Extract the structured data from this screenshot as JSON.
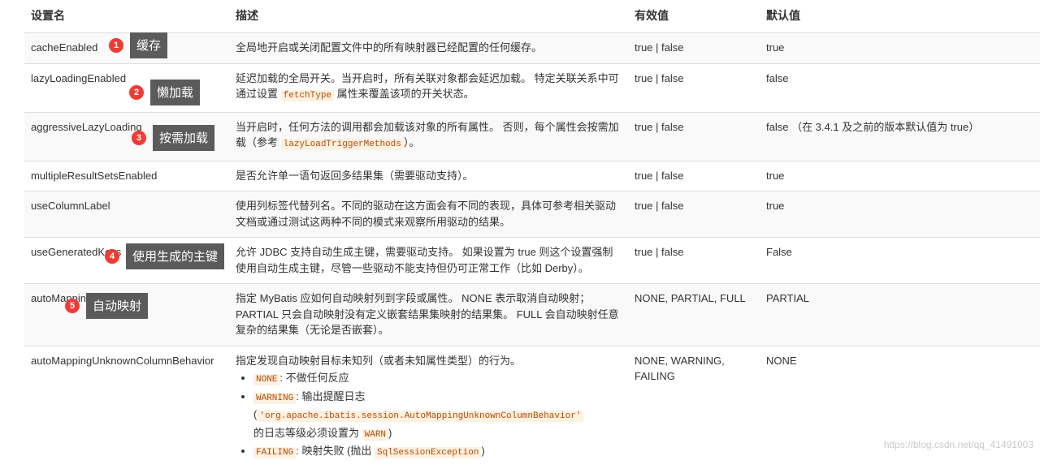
{
  "headers": [
    "设置名",
    "描述",
    "有效值",
    "默认值"
  ],
  "rows": [
    {
      "name": "cacheEnabled",
      "desc": "全局地开启或关闭配置文件中的所有映射器已经配置的任何缓存。",
      "valid": "true | false",
      "default": "true"
    },
    {
      "name": "lazyLoadingEnabled",
      "desc_pre": "延迟加载的全局开关。当开启时，所有关联对象都会延迟加载。 特定关联关系中可通过设置 ",
      "desc_code": "fetchType",
      "desc_post": " 属性来覆盖该项的开关状态。",
      "valid": "true | false",
      "default": "false"
    },
    {
      "name": "aggressiveLazyLoading",
      "desc_pre": "当开启时，任何方法的调用都会加载该对象的所有属性。 否则，每个属性会按需加载（参考 ",
      "desc_code": "lazyLoadTriggerMethods",
      "desc_post": "）。",
      "valid": "true | false",
      "default": "false （在 3.4.1 及之前的版本默认值为 true）"
    },
    {
      "name": "multipleResultSetsEnabled",
      "desc": "是否允许单一语句返回多结果集（需要驱动支持）。",
      "valid": "true | false",
      "default": "true"
    },
    {
      "name": "useColumnLabel",
      "desc": "使用列标签代替列名。不同的驱动在这方面会有不同的表现，具体可参考相关驱动文档或通过测试这两种不同的模式来观察所用驱动的结果。",
      "valid": "true | false",
      "default": "true"
    },
    {
      "name": "useGeneratedKeys",
      "desc": "允许 JDBC 支持自动生成主键，需要驱动支持。 如果设置为 true 则这个设置强制使用自动生成主键，尽管一些驱动不能支持但仍可正常工作（比如 Derby）。",
      "valid": "true | false",
      "default": "False"
    },
    {
      "name": "autoMappingBehavior",
      "desc": "指定 MyBatis 应如何自动映射列到字段或属性。 NONE 表示取消自动映射；PARTIAL 只会自动映射没有定义嵌套结果集映射的结果集。 FULL 会自动映射任意复杂的结果集（无论是否嵌套）。",
      "valid": "NONE, PARTIAL, FULL",
      "default": "PARTIAL"
    },
    {
      "name": "autoMappingUnknownColumnBehavior",
      "desc": "指定发现自动映射目标未知列（或者未知属性类型）的行为。",
      "bullets": {
        "b1_code": "NONE",
        "b1_text": ": 不做任何反应",
        "b2_code": "WARNING",
        "b2_text": ": 输出提醒日志",
        "b2_paren_open": "(",
        "b2_code2": "'org.apache.ibatis.session.AutoMappingUnknownColumnBehavior'",
        "b2_mid": " 的日志等级必须设置为 ",
        "b2_code3": "WARN",
        "b2_paren_close": ")",
        "b3_code": "FAILING",
        "b3_text": ": 映射失败 (抛出 ",
        "b3_code2": "SqlSessionException",
        "b3_close": ")"
      },
      "valid": "NONE, WARNING, FAILING",
      "default": "NONE"
    }
  ],
  "annotations": [
    {
      "num": "1",
      "label": "缓存"
    },
    {
      "num": "2",
      "label": "懒加载"
    },
    {
      "num": "3",
      "label": "按需加载"
    },
    {
      "num": "4",
      "label": "使用生成的主键"
    },
    {
      "num": "5",
      "label": "自动映射"
    }
  ],
  "colors": {
    "annotation_number_bg": "#ef3b36",
    "annotation_label_bg": "#5b5b5b",
    "code_bg": "#fdf1e1",
    "stripe_bg": "#f9f9f9"
  },
  "watermark": "https://blog.csdn.net/qq_41491003"
}
